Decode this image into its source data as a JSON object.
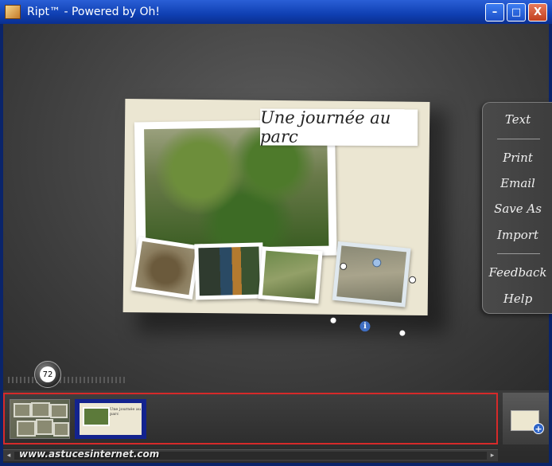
{
  "window": {
    "title": "Ript™ - Powered by Oh!",
    "minimize_glyph": "–",
    "maximize_glyph": "□",
    "close_glyph": "X"
  },
  "card": {
    "title": "Une journée au parc",
    "info_glyph": "i"
  },
  "side_menu": {
    "items": [
      "Text",
      "Print",
      "Email",
      "Save As",
      "Import",
      "Feedback",
      "Help"
    ]
  },
  "zoom": {
    "value": "72"
  },
  "pages": {
    "thumb2_title": "Une journée au parc",
    "add_glyph": "+"
  },
  "scrollbar": {
    "left_glyph": "◂",
    "right_glyph": "▸"
  },
  "watermark": "www.astucesinternet.com",
  "icons": {
    "app": "ript-app-icon",
    "info": "info-icon",
    "add_page": "add-page-icon"
  },
  "colors": {
    "titlebar": "#0f3fb2",
    "highlight_border": "#d62a2a",
    "selected_page": "#13238e",
    "card_bg": "#ebe6d2"
  }
}
